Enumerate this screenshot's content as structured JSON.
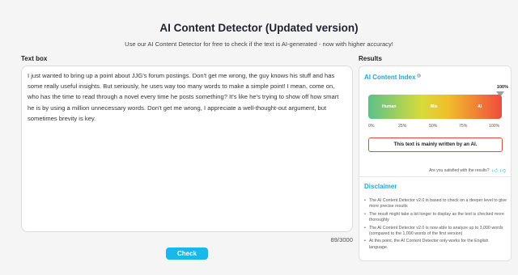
{
  "header": {
    "title": "AI Content Detector (Updated version)",
    "subtitle": "Use our AI Content Detector for free to check if the text is AI-generated - now with higher accuracy!"
  },
  "textbox": {
    "label": "Text box",
    "content": "I just wanted to bring up a point about JJG's forum postings. Don't get me wrong, the guy knows his stuff and has some really useful insights. But seriously, he uses way too many words to make a simple point! I mean, come on, who has the time to read through a novel every time he posts something? It's like he's trying to show off how smart he is by using a million unnecessary words. Don't get me wrong, I appreciate a well-thought-out argument, but sometimes brevity is key.",
    "counter": "89/3000",
    "check_label": "Check"
  },
  "results": {
    "label": "Results",
    "index_title": "AI Content Index",
    "info_glyph": "i",
    "percent": "100%",
    "score_fraction": 1.0,
    "bar_labels": {
      "human": "Human",
      "mix": "Mix",
      "ai": "AI"
    },
    "ticks": [
      "0%",
      "25%",
      "50%",
      "75%",
      "100%"
    ],
    "verdict": "This text is mainly written by an AI.",
    "satisfied_prompt": "Are you satisfied with the results?",
    "thumb_up_icon": "thumbs-up-icon",
    "thumb_down_icon": "thumbs-down-icon"
  },
  "disclaimer": {
    "title": "Disclaimer",
    "items": [
      "The AI Content Detector v2.0 is based to check on a deeper level to give more precise results",
      "The result might take a bit longer to display as the text is checked more thoroughly",
      "The AI Content Detector v2.0 is now able to analyze up to 3,000 words (compared to the 1,000 words of the first version)",
      "At this point, the AI Content Detector only works for the English language."
    ]
  },
  "colors": {
    "accent": "#18b8ea",
    "verdict_border": "#e24b3b",
    "gradient_start": "#5cc08a",
    "gradient_end": "#ef4b3c"
  }
}
